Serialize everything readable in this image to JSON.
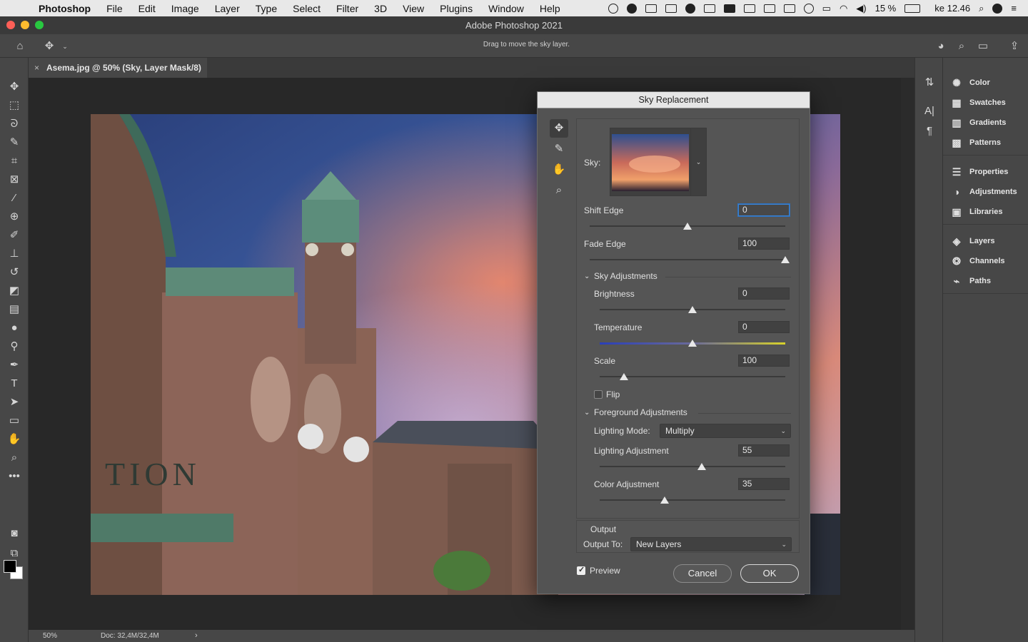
{
  "menubar": {
    "app": "Photoshop",
    "items": [
      "File",
      "Edit",
      "Image",
      "Layer",
      "Type",
      "Select",
      "Filter",
      "3D",
      "View",
      "Plugins",
      "Window",
      "Help"
    ],
    "battery": "15 %",
    "clock": "ke 12.46"
  },
  "window": {
    "title": "Adobe Photoshop 2021"
  },
  "options_bar": {
    "hint": "Drag to move the sky layer."
  },
  "document": {
    "tab_title": "Asema.jpg @ 50% (Sky, Layer Mask/8)",
    "zoom": "50%",
    "doc_info": "Doc: 32,4M/32,4M"
  },
  "panels": {
    "items": [
      {
        "label": "Color",
        "icon": "color-icon"
      },
      {
        "label": "Swatches",
        "icon": "swatches-icon"
      },
      {
        "label": "Gradients",
        "icon": "gradients-icon"
      },
      {
        "label": "Patterns",
        "icon": "patterns-icon"
      },
      {
        "label": "Properties",
        "icon": "properties-icon"
      },
      {
        "label": "Adjustments",
        "icon": "adjustments-icon"
      },
      {
        "label": "Libraries",
        "icon": "libraries-icon"
      },
      {
        "label": "Layers",
        "icon": "layers-icon"
      },
      {
        "label": "Channels",
        "icon": "channels-icon"
      },
      {
        "label": "Paths",
        "icon": "paths-icon"
      }
    ]
  },
  "dialog": {
    "title": "Sky Replacement",
    "sky_label": "Sky:",
    "shift_edge": {
      "label": "Shift Edge",
      "value": "0",
      "level": 0.5
    },
    "fade_edge": {
      "label": "Fade Edge",
      "value": "100",
      "level": 1.0
    },
    "sky_adjustments": {
      "header": "Sky Adjustments",
      "brightness": {
        "label": "Brightness",
        "value": "0",
        "level": 0.5
      },
      "temperature": {
        "label": "Temperature",
        "value": "0",
        "level": 0.5
      },
      "scale": {
        "label": "Scale",
        "value": "100",
        "level": 0.13
      },
      "flip": {
        "label": "Flip",
        "checked": false
      }
    },
    "foreground_adjustments": {
      "header": "Foreground Adjustments",
      "lighting_mode": {
        "label": "Lighting Mode:",
        "value": "Multiply"
      },
      "lighting_adjustment": {
        "label": "Lighting Adjustment",
        "value": "55",
        "level": 0.55
      },
      "color_adjustment": {
        "label": "Color Adjustment",
        "value": "35",
        "level": 0.35
      }
    },
    "output": {
      "header": "Output",
      "label": "Output To:",
      "value": "New Layers"
    },
    "preview": {
      "label": "Preview",
      "checked": true
    },
    "cancel": "Cancel",
    "ok": "OK"
  },
  "image_text": {
    "station_sign": "TION"
  },
  "colors": {
    "accent": "#3a84d6",
    "panel": "#474747",
    "canvas": "#282828",
    "dialog": "#535353"
  }
}
